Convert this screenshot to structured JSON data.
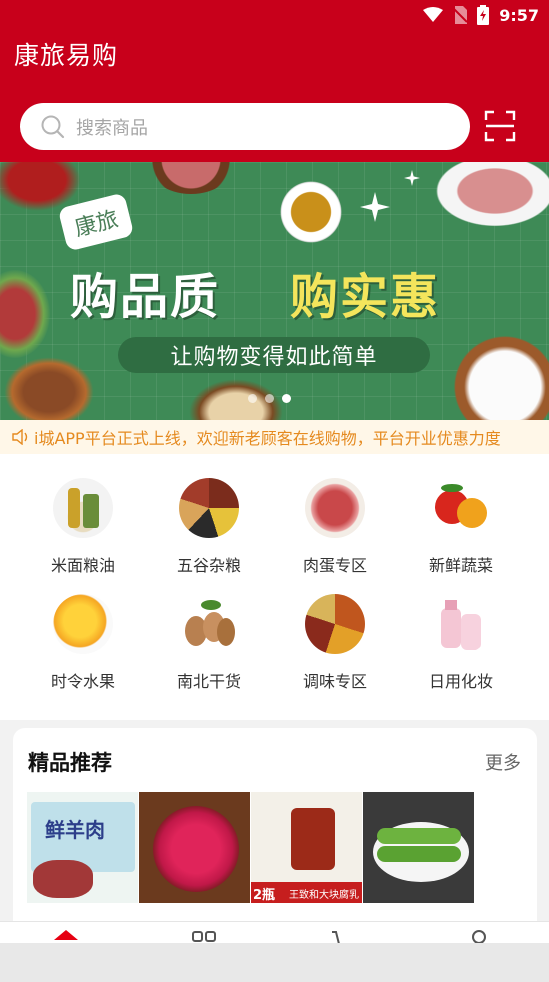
{
  "status_bar": {
    "time": "9:57"
  },
  "header": {
    "title": "康旅易购"
  },
  "search": {
    "placeholder": "搜索商品"
  },
  "banner": {
    "brand": "康旅",
    "title_left": "购品质",
    "title_right": "购实惠",
    "subtitle": "让购物变得如此简单"
  },
  "notice": {
    "text": "i城APP平台正式上线，欢迎新老顾客在线购物，平台开业优惠力度"
  },
  "categories": [
    {
      "label": "米面粮油",
      "icon": "rice-oil-icon"
    },
    {
      "label": "五谷杂粮",
      "icon": "grains-icon"
    },
    {
      "label": "肉蛋专区",
      "icon": "meat-icon"
    },
    {
      "label": "新鲜蔬菜",
      "icon": "vegetables-icon"
    },
    {
      "label": "时令水果",
      "icon": "mango-icon"
    },
    {
      "label": "南北干货",
      "icon": "nuts-icon"
    },
    {
      "label": "调味专区",
      "icon": "spices-icon"
    },
    {
      "label": "日用化妆",
      "icon": "cosmetics-icon"
    }
  ],
  "recommend": {
    "title": "精品推荐",
    "more": "更多",
    "products": [
      {
        "badge": "鲜羊肉"
      },
      {
        "badge": ""
      },
      {
        "badge": "2瓶",
        "caption": "王致和大块腐乳"
      },
      {
        "badge": ""
      }
    ]
  },
  "colors": {
    "brand_red": "#c8001b",
    "banner_green": "#3e8a56",
    "notice_orange": "#e58a1f"
  }
}
